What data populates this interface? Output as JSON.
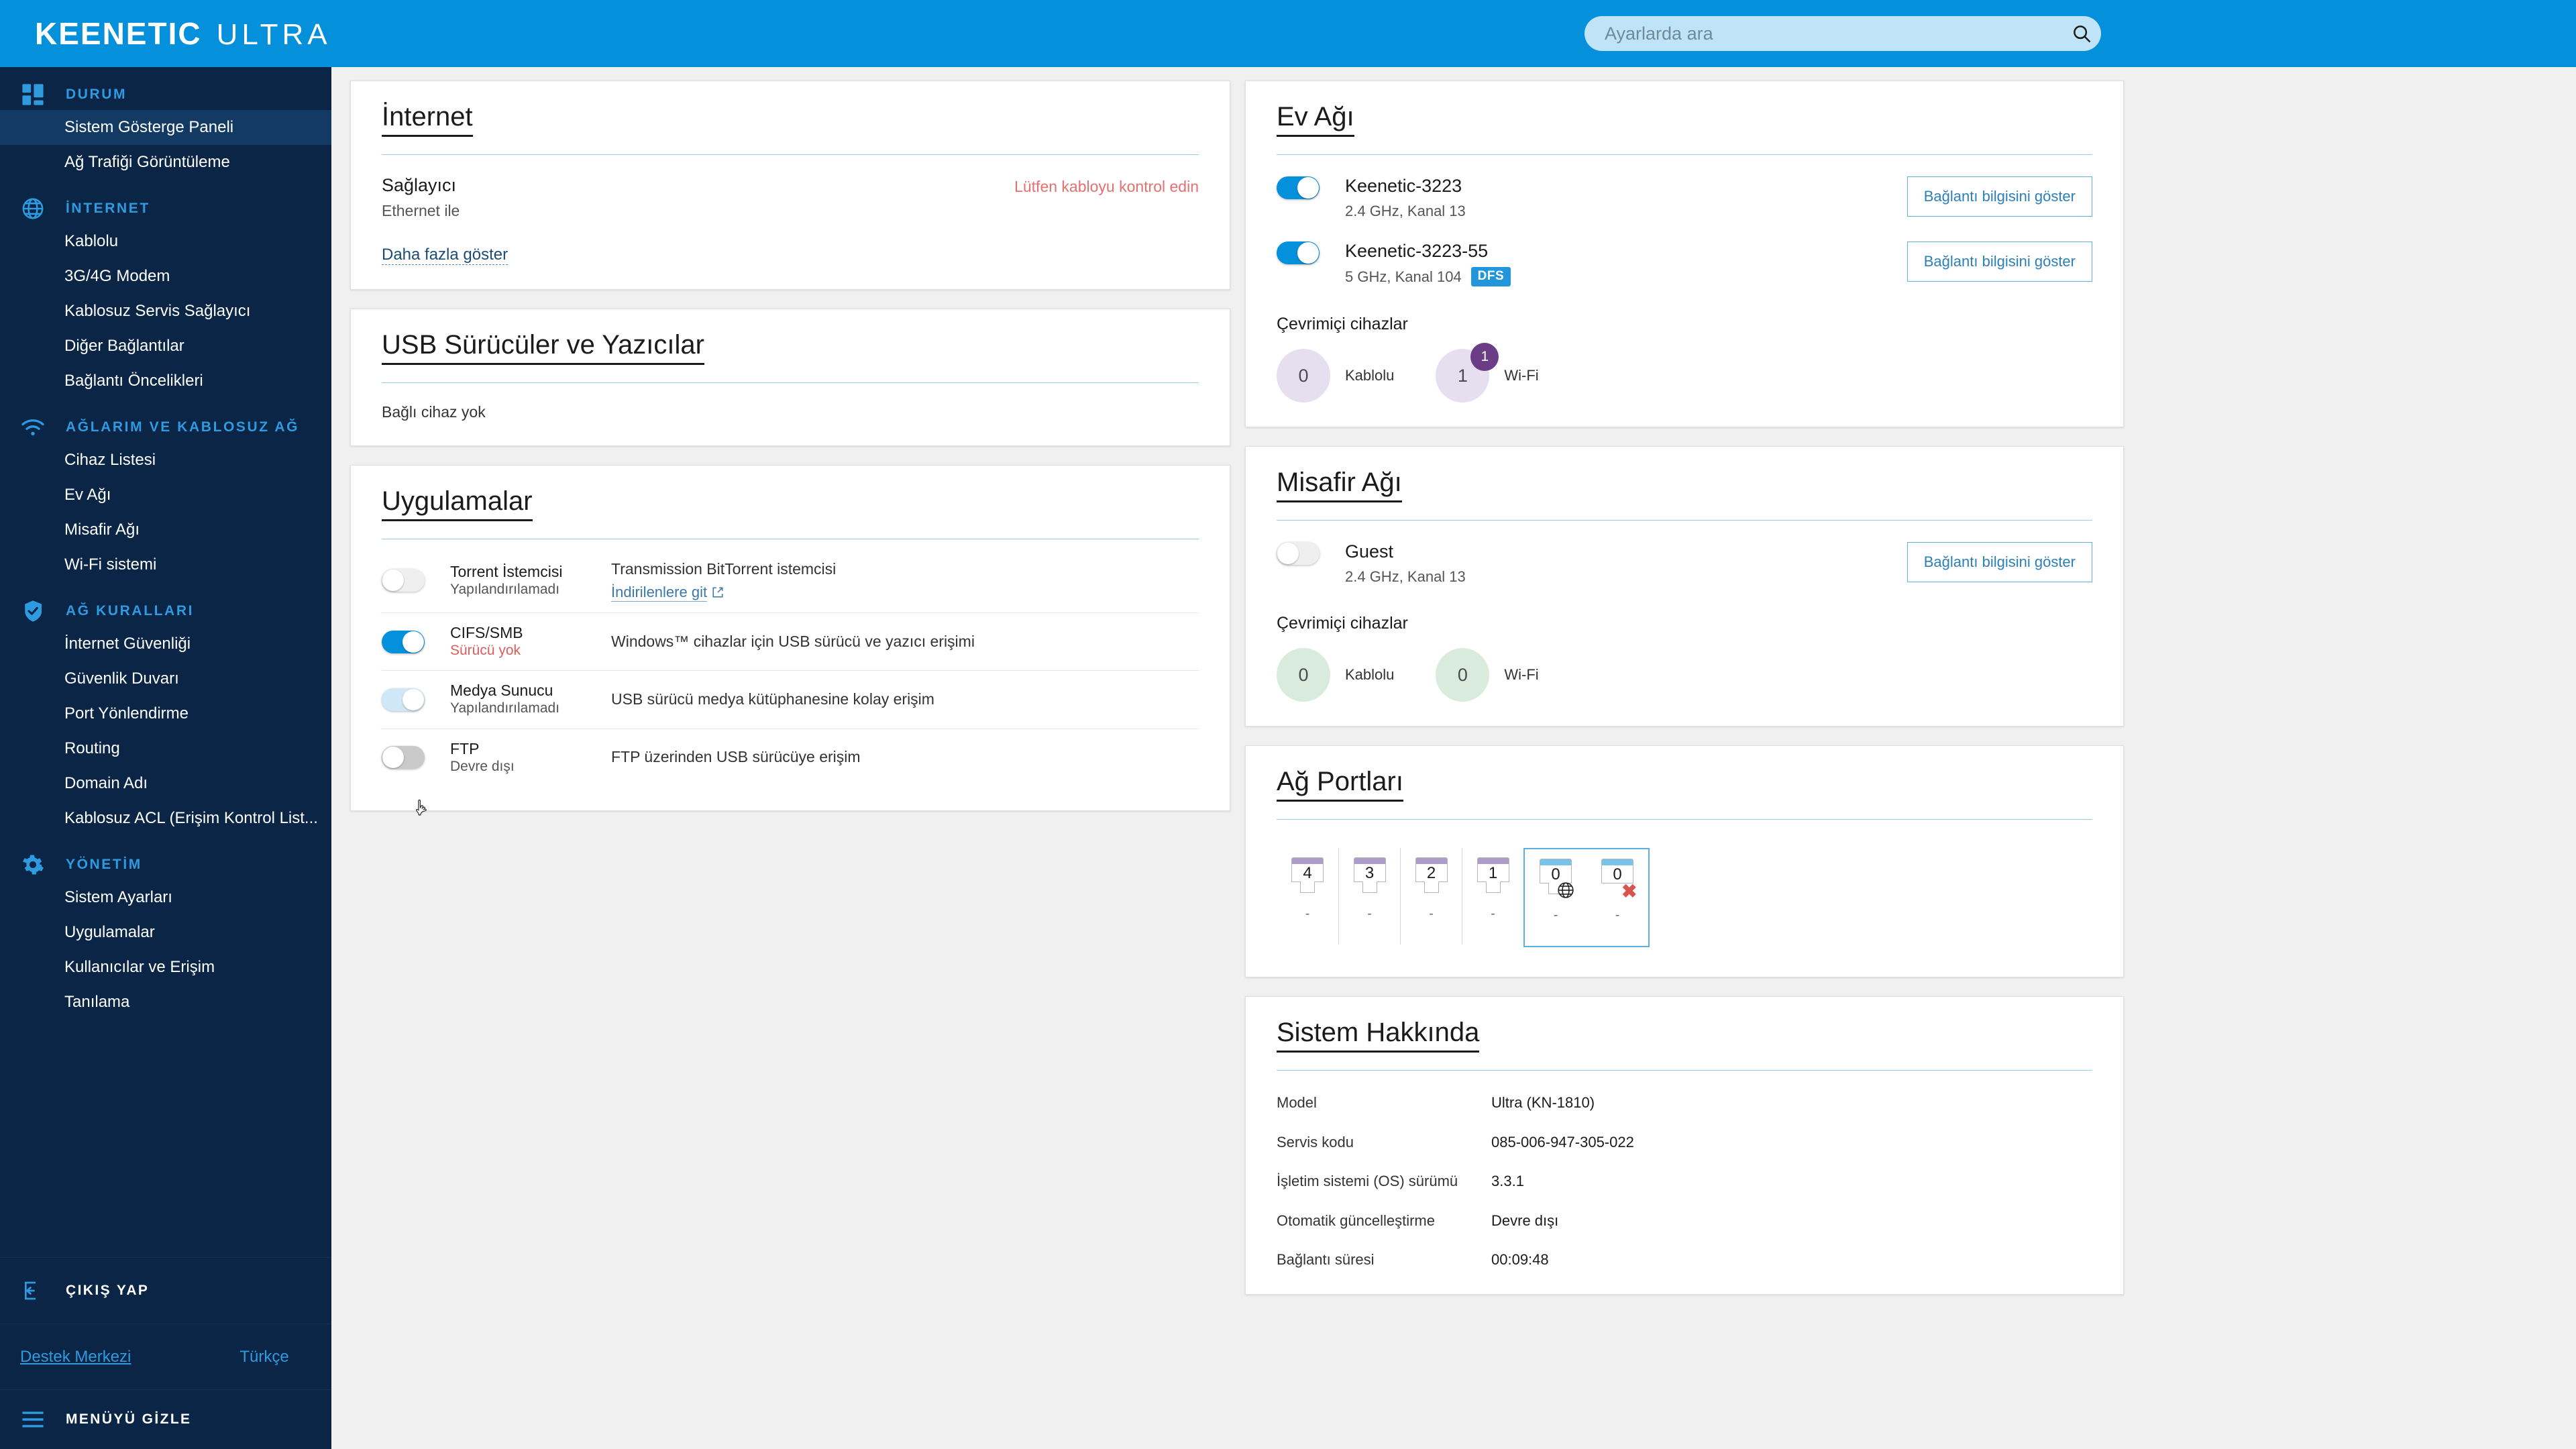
{
  "header": {
    "brand": "KEENETIC",
    "model": "ULTRA",
    "search_placeholder": "Ayarlarda ara",
    "search_value": ""
  },
  "sidebar": {
    "groups": [
      {
        "title": "DURUM",
        "icon": "dashboard-icon",
        "items": [
          {
            "label": "Sistem Gösterge Paneli",
            "active": true
          },
          {
            "label": "Ağ Trafiği Görüntüleme",
            "active": false
          }
        ]
      },
      {
        "title": "İNTERNET",
        "icon": "globe-icon",
        "items": [
          {
            "label": "Kablolu",
            "active": false
          },
          {
            "label": "3G/4G Modem",
            "active": false
          },
          {
            "label": "Kablosuz Servis Sağlayıcı",
            "active": false
          },
          {
            "label": "Diğer Bağlantılar",
            "active": false
          },
          {
            "label": "Bağlantı Öncelikleri",
            "active": false
          }
        ]
      },
      {
        "title": "AĞLARIM VE KABLOSUZ AĞ",
        "icon": "wifi-icon",
        "items": [
          {
            "label": "Cihaz Listesi",
            "active": false
          },
          {
            "label": "Ev Ağı",
            "active": false
          },
          {
            "label": "Misafir Ağı",
            "active": false
          },
          {
            "label": "Wi-Fi sistemi",
            "active": false
          }
        ]
      },
      {
        "title": "AĞ KURALLARI",
        "icon": "shield-check-icon",
        "items": [
          {
            "label": "İnternet Güvenliği",
            "active": false
          },
          {
            "label": "Güvenlik Duvarı",
            "active": false
          },
          {
            "label": "Port Yönlendirme",
            "active": false
          },
          {
            "label": "Routing",
            "active": false
          },
          {
            "label": "Domain Adı",
            "active": false
          },
          {
            "label": "Kablosuz ACL (Erişim Kontrol List...",
            "active": false
          }
        ]
      },
      {
        "title": "YÖNETİM",
        "icon": "gear-icon",
        "items": [
          {
            "label": "Sistem Ayarları",
            "active": false
          },
          {
            "label": "Uygulamalar",
            "active": false
          },
          {
            "label": "Kullanıcılar ve Erişim",
            "active": false
          },
          {
            "label": "Tanılama",
            "active": false
          }
        ]
      }
    ],
    "logout_label": "ÇIKIŞ YAP",
    "support_link": "Destek Merkezi",
    "language": "Türkçe",
    "hide_menu_label": "MENÜYÜ GİZLE"
  },
  "internet_card": {
    "title": "İnternet",
    "provider_label": "Sağlayıcı",
    "provider_value": "Ethernet ile",
    "error": "Lütfen kabloyu kontrol edin",
    "show_more": "Daha fazla göster"
  },
  "usb_card": {
    "title": "USB Sürücüler ve Yazıcılar",
    "empty": "Bağlı cihaz yok"
  },
  "apps_card": {
    "title": "Uygulamalar",
    "rows": [
      {
        "toggle": "off",
        "name": "Torrent İstemcisi",
        "state": "Yapılandırılamadı",
        "state_error": false,
        "desc": "Transmission BitTorrent istemcisi",
        "link": "İndirilenlere git"
      },
      {
        "toggle": "on",
        "name": "CIFS/SMB",
        "state": "Sürücü yok",
        "state_error": true,
        "desc": "Windows™ cihazlar için USB sürücü ve yazıcı erişimi",
        "link": ""
      },
      {
        "toggle": "part",
        "name": "Medya Sunucu",
        "state": "Yapılandırılamadı",
        "state_error": false,
        "desc": "USB sürücü medya kütüphanesine kolay erişim",
        "link": ""
      },
      {
        "toggle": "offd",
        "name": "FTP",
        "state": "Devre dışı",
        "state_error": false,
        "desc": "FTP üzerinden USB sürücüye erişim",
        "link": ""
      }
    ]
  },
  "home_network_card": {
    "title": "Ev Ağı",
    "networks": [
      {
        "toggle": "on",
        "name": "Keenetic-3223",
        "meta": "2.4 GHz, Kanal 13",
        "badge": "",
        "button": "Bağlantı bilgisini göster"
      },
      {
        "toggle": "on",
        "name": "Keenetic-3223-55",
        "meta": "5 GHz, Kanal 104",
        "badge": "DFS",
        "button": "Bağlantı bilgisini göster"
      }
    ],
    "online_label": "Çevrimiçi cihazlar",
    "counters": [
      {
        "value": "0",
        "label": "Kablolu",
        "badge": ""
      },
      {
        "value": "1",
        "label": "Wi-Fi",
        "badge": "1"
      }
    ]
  },
  "guest_network_card": {
    "title": "Misafir Ağı",
    "networks": [
      {
        "toggle": "off",
        "name": "Guest",
        "meta": "2.4 GHz, Kanal 13",
        "badge": "",
        "button": "Bağlantı bilgisini göster"
      }
    ],
    "online_label": "Çevrimiçi cihazlar",
    "counters": [
      {
        "value": "0",
        "label": "Kablolu",
        "badge": ""
      },
      {
        "value": "0",
        "label": "Wi-Fi",
        "badge": ""
      }
    ]
  },
  "ports_card": {
    "title": "Ağ Portları",
    "ports": [
      {
        "num": "4",
        "cap": "purple",
        "sub": "-",
        "icon": "",
        "wan": false
      },
      {
        "num": "3",
        "cap": "purple",
        "sub": "-",
        "icon": "",
        "wan": false
      },
      {
        "num": "2",
        "cap": "purple",
        "sub": "-",
        "icon": "",
        "wan": false
      },
      {
        "num": "1",
        "cap": "purple",
        "sub": "-",
        "icon": "",
        "wan": false
      },
      {
        "num": "0",
        "cap": "blue",
        "sub": "-",
        "icon": "globe",
        "wan": true
      },
      {
        "num": "0",
        "cap": "blue",
        "sub": "-",
        "icon": "cross",
        "wan": true
      }
    ]
  },
  "system_card": {
    "title": "Sistem Hakkında",
    "rows": [
      {
        "key": "Model",
        "value": "Ultra (KN-1810)"
      },
      {
        "key": "Servis kodu",
        "value": "085-006-947-305-022"
      },
      {
        "key": "İşletim sistemi (OS) sürümü",
        "value": "3.3.1"
      },
      {
        "key": "Otomatik güncelleştirme",
        "value": "Devre dışı"
      },
      {
        "key": "Bağlantı süresi",
        "value": "00:09:48"
      }
    ]
  },
  "colors": {
    "header_blue": "#0590dc",
    "sidebar_navy": "#0a2545",
    "sidebar_active": "#133a63",
    "accent_blue": "#2e9ae0",
    "error_red": "#e4706f",
    "badge_purple": "#6b3d86",
    "bubble_purple": "#e6dff0",
    "bubble_green": "#d9ebdc",
    "port_lan": "#ae9cc8",
    "port_wan": "#79c2e8"
  }
}
